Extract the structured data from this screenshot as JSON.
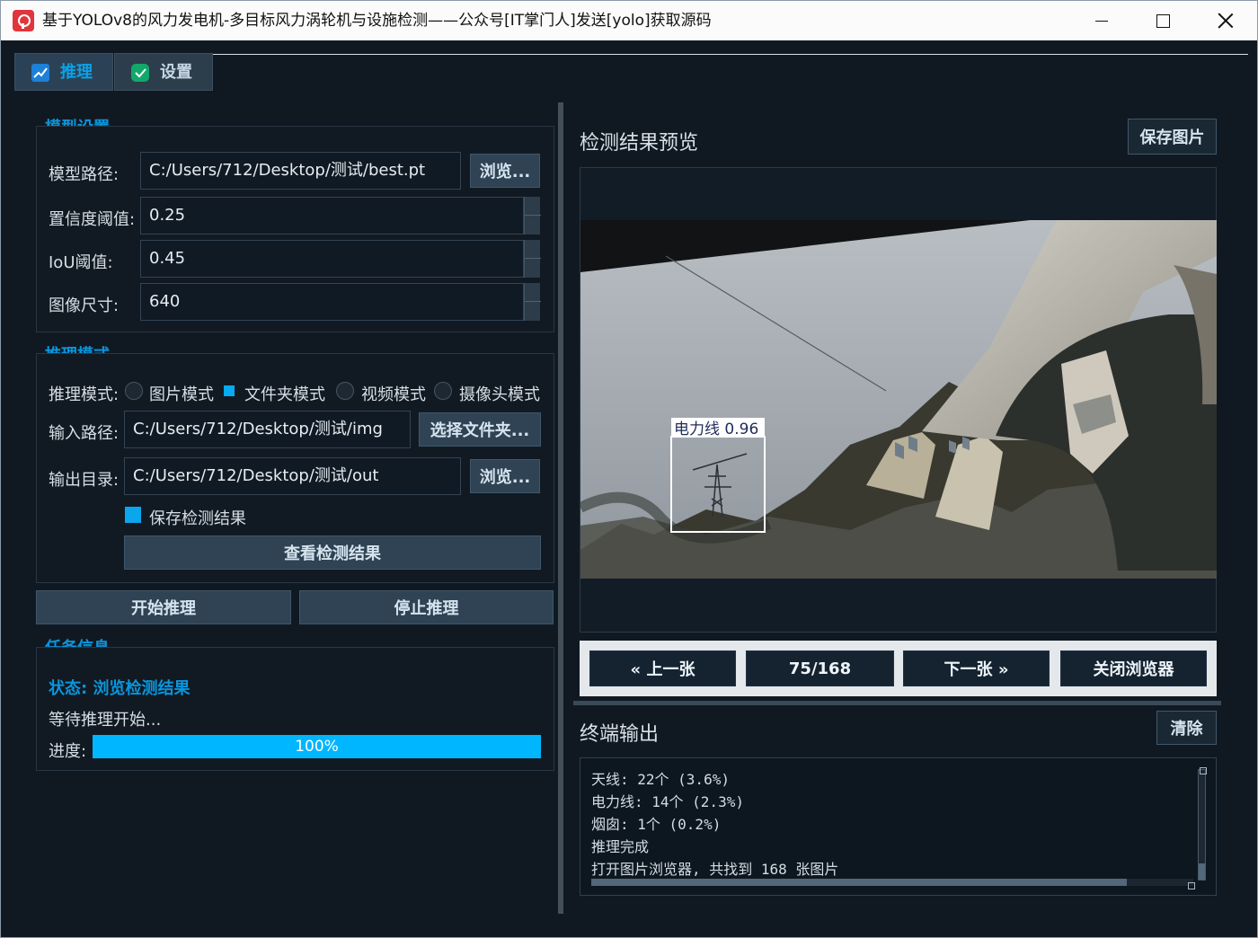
{
  "window": {
    "title": "基于YOLOv8的风力发电机-多目标风力涡轮机与设施检测——公众号[IT掌门人]发送[yolo]获取源码"
  },
  "tabs": [
    {
      "label": "推理"
    },
    {
      "label": "设置"
    }
  ],
  "model_settings": {
    "title": "模型设置",
    "model_path_label": "模型路径:",
    "model_path_value": "C:/Users/712/Desktop/测试/best.pt",
    "browse_label": "浏览...",
    "confidence_label": "置信度阈值:",
    "confidence_value": "0.25",
    "iou_label": "IoU阈值:",
    "iou_value": "0.45",
    "image_size_label": "图像尺寸:",
    "image_size_value": "640"
  },
  "inference_mode": {
    "title": "推理模式",
    "mode_label": "推理模式:",
    "options": [
      "图片模式",
      "文件夹模式",
      "视频模式",
      "摄像头模式"
    ],
    "selected": "文件夹模式",
    "input_path_label": "输入路径:",
    "input_path_value": "C:/Users/712/Desktop/测试/img",
    "select_folder_label": "选择文件夹...",
    "output_dir_label": "输出目录:",
    "output_dir_value": "C:/Users/712/Desktop/测试/out",
    "output_browse_label": "浏览...",
    "save_results_label": "保存检测结果",
    "view_results_label": "查看检测结果"
  },
  "actions": {
    "start_label": "开始推理",
    "stop_label": "停止推理"
  },
  "task_info": {
    "title": "任务信息",
    "status_label": "状态: 浏览检测结果",
    "message": "等待推理开始...",
    "progress_label": "进度:",
    "progress_value": 100,
    "progress_text": "100%"
  },
  "preview": {
    "title": "检测结果预览",
    "save_label": "保存图片",
    "detection_label": "电力线 0.96"
  },
  "navigation": {
    "prev_label": "« 上一张",
    "counter": "75/168",
    "next_label": "下一张 »",
    "close_label": "关闭浏览器"
  },
  "terminal": {
    "title": "终端输出",
    "clear_label": "清除",
    "lines": [
      "  天线: 22个 (3.6%)",
      "  电力线: 14个 (2.3%)",
      "  烟囱: 1个 (0.2%)",
      "推理完成",
      "打开图片浏览器, 共找到 168 张图片"
    ]
  },
  "colors": {
    "accent": "#0aa2e8",
    "background": "#101922",
    "progress": "#00b6ff",
    "detection_box": "#ffffff"
  },
  "icons": {
    "inference_tab": "chart-icon",
    "settings_tab": "check-icon",
    "window_app": "app-logo-icon"
  }
}
